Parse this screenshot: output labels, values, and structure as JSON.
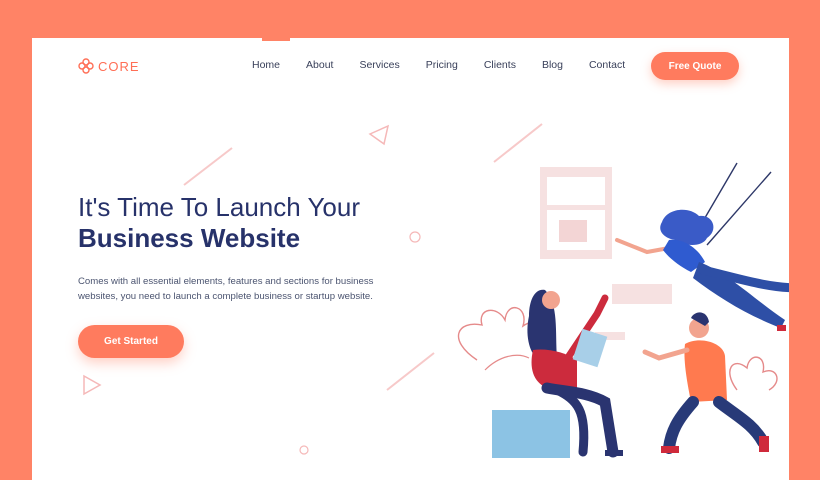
{
  "brand": {
    "name": "CORE",
    "color": "#ff6e55"
  },
  "nav": {
    "items": [
      "Home",
      "About",
      "Services",
      "Pricing",
      "Clients",
      "Blog",
      "Contact"
    ],
    "quote_label": "Free Quote"
  },
  "hero": {
    "headline_line1": "It's Time To Launch Your",
    "headline_line2": "Business Website",
    "description": "Comes with all essential elements, features and sections for business websites, you need to launch a complete business or startup website.",
    "cta_label": "Get Started"
  },
  "colors": {
    "background": "#ff8366",
    "accent": "#ff7b5e",
    "heading": "#27326a"
  },
  "icons": [
    "logo-icon",
    "hero-illustration"
  ]
}
